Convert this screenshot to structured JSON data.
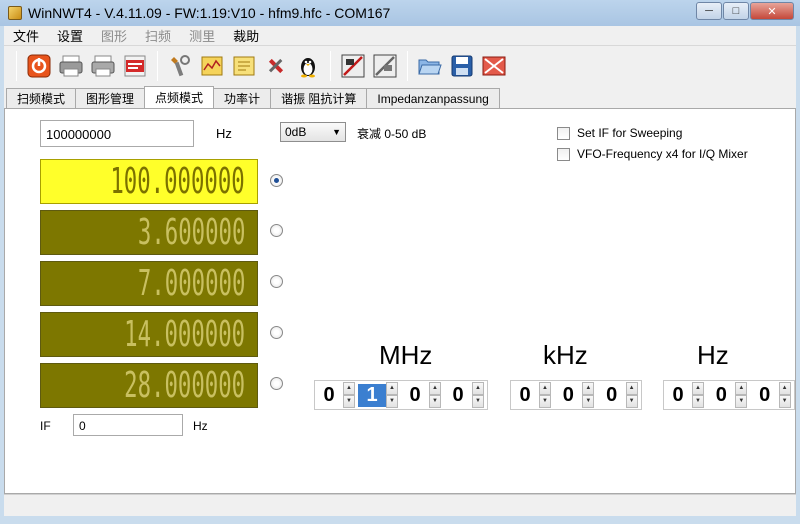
{
  "window": {
    "title": "WinNWT4 - V.4.11.09 - FW:1.19:V10 - hfm9.hfc - COM167",
    "minimize_glyph": "─",
    "maximize_glyph": "□",
    "close_glyph": "✕"
  },
  "menu": [
    {
      "label": "文件",
      "enabled": true
    },
    {
      "label": "设置",
      "enabled": true
    },
    {
      "label": "图形",
      "enabled": false
    },
    {
      "label": "扫频",
      "enabled": false
    },
    {
      "label": "测里",
      "enabled": false
    },
    {
      "label": "裁助",
      "enabled": true
    }
  ],
  "toolbar_icons": [
    "power-icon",
    "printer-icon",
    "printer-color-icon",
    "png-export-icon",
    "wrench-icon",
    "graph-yellow-icon",
    "graph-mark-icon",
    "tools-icon",
    "tux-icon",
    "calibration-icon",
    "calibration-2-icon",
    "open-folder-icon",
    "save-icon",
    "close-file-icon"
  ],
  "tabs": [
    {
      "label": "扫频模式",
      "active": false
    },
    {
      "label": "图形管理",
      "active": false
    },
    {
      "label": "点频模式",
      "active": true
    },
    {
      "label": "功率计",
      "active": false
    },
    {
      "label": "谐振 阻抗计算",
      "active": false
    },
    {
      "label": "Impedanzanpassung",
      "active": false
    }
  ],
  "vfo": {
    "frequency_value": "100000000",
    "frequency_unit": "Hz",
    "attenuation_selected": "0dB",
    "attenuation_label": "衰减 0-50 dB",
    "set_if_label": "Set  IF for Sweeping",
    "set_if_checked": false,
    "vfo_x4_label": "VFO-Frequency x4 for I/Q Mixer",
    "vfo_x4_checked": false
  },
  "lcd_displays": [
    {
      "value": "100.000000",
      "selected": true
    },
    {
      "value": "3.600000",
      "selected": false
    },
    {
      "value": "7.000000",
      "selected": false
    },
    {
      "value": "14.000000",
      "selected": false
    },
    {
      "value": "28.000000",
      "selected": false
    }
  ],
  "if_field": {
    "label": "IF",
    "value": "0",
    "unit": "Hz"
  },
  "units": {
    "mhz": "MHz",
    "khz": "kHz",
    "hz": "Hz"
  },
  "spinners": {
    "mhz": [
      "0",
      "1",
      "0",
      "0"
    ],
    "khz": [
      "0",
      "0",
      "0"
    ],
    "hz": [
      "0",
      "0",
      "0"
    ],
    "focused": "mhz.1"
  },
  "colors": {
    "lcd_active": "#ffff2a",
    "lcd_inactive": "#7d7700",
    "focus": "#3b7fd0"
  }
}
